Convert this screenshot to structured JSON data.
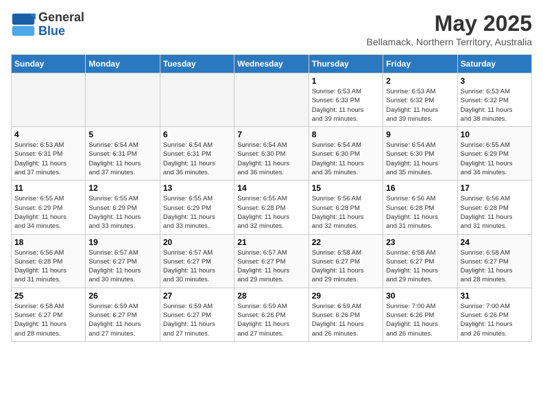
{
  "header": {
    "logo_line1": "General",
    "logo_line2": "Blue",
    "title": "May 2025",
    "subtitle": "Bellamack, Northern Territory, Australia"
  },
  "days_of_week": [
    "Sunday",
    "Monday",
    "Tuesday",
    "Wednesday",
    "Thursday",
    "Friday",
    "Saturday"
  ],
  "weeks": [
    [
      {
        "day": "",
        "empty": true
      },
      {
        "day": "",
        "empty": true
      },
      {
        "day": "",
        "empty": true
      },
      {
        "day": "",
        "empty": true
      },
      {
        "day": "1",
        "lines": [
          "Sunrise: 6:53 AM",
          "Sunset: 6:33 PM",
          "Daylight: 11 hours",
          "and 39 minutes."
        ]
      },
      {
        "day": "2",
        "lines": [
          "Sunrise: 6:53 AM",
          "Sunset: 6:32 PM",
          "Daylight: 11 hours",
          "and 39 minutes."
        ]
      },
      {
        "day": "3",
        "lines": [
          "Sunrise: 6:53 AM",
          "Sunset: 6:32 PM",
          "Daylight: 11 hours",
          "and 38 minutes."
        ]
      }
    ],
    [
      {
        "day": "4",
        "lines": [
          "Sunrise: 6:53 AM",
          "Sunset: 6:31 PM",
          "Daylight: 11 hours",
          "and 37 minutes."
        ]
      },
      {
        "day": "5",
        "lines": [
          "Sunrise: 6:54 AM",
          "Sunset: 6:31 PM",
          "Daylight: 11 hours",
          "and 37 minutes."
        ]
      },
      {
        "day": "6",
        "lines": [
          "Sunrise: 6:54 AM",
          "Sunset: 6:31 PM",
          "Daylight: 11 hours",
          "and 36 minutes."
        ]
      },
      {
        "day": "7",
        "lines": [
          "Sunrise: 6:54 AM",
          "Sunset: 6:30 PM",
          "Daylight: 11 hours",
          "and 36 minutes."
        ]
      },
      {
        "day": "8",
        "lines": [
          "Sunrise: 6:54 AM",
          "Sunset: 6:30 PM",
          "Daylight: 11 hours",
          "and 35 minutes."
        ]
      },
      {
        "day": "9",
        "lines": [
          "Sunrise: 6:54 AM",
          "Sunset: 6:30 PM",
          "Daylight: 11 hours",
          "and 35 minutes."
        ]
      },
      {
        "day": "10",
        "lines": [
          "Sunrise: 6:55 AM",
          "Sunset: 6:29 PM",
          "Daylight: 11 hours",
          "and 34 minutes."
        ]
      }
    ],
    [
      {
        "day": "11",
        "lines": [
          "Sunrise: 6:55 AM",
          "Sunset: 6:29 PM",
          "Daylight: 11 hours",
          "and 34 minutes."
        ]
      },
      {
        "day": "12",
        "lines": [
          "Sunrise: 6:55 AM",
          "Sunset: 6:29 PM",
          "Daylight: 11 hours",
          "and 33 minutes."
        ]
      },
      {
        "day": "13",
        "lines": [
          "Sunrise: 6:55 AM",
          "Sunset: 6:29 PM",
          "Daylight: 11 hours",
          "and 33 minutes."
        ]
      },
      {
        "day": "14",
        "lines": [
          "Sunrise: 6:55 AM",
          "Sunset: 6:28 PM",
          "Daylight: 11 hours",
          "and 32 minutes."
        ]
      },
      {
        "day": "15",
        "lines": [
          "Sunrise: 6:56 AM",
          "Sunset: 6:28 PM",
          "Daylight: 11 hours",
          "and 32 minutes."
        ]
      },
      {
        "day": "16",
        "lines": [
          "Sunrise: 6:56 AM",
          "Sunset: 6:28 PM",
          "Daylight: 11 hours",
          "and 31 minutes."
        ]
      },
      {
        "day": "17",
        "lines": [
          "Sunrise: 6:56 AM",
          "Sunset: 6:28 PM",
          "Daylight: 11 hours",
          "and 31 minutes."
        ]
      }
    ],
    [
      {
        "day": "18",
        "lines": [
          "Sunrise: 6:56 AM",
          "Sunset: 6:28 PM",
          "Daylight: 11 hours",
          "and 31 minutes."
        ]
      },
      {
        "day": "19",
        "lines": [
          "Sunrise: 6:57 AM",
          "Sunset: 6:27 PM",
          "Daylight: 11 hours",
          "and 30 minutes."
        ]
      },
      {
        "day": "20",
        "lines": [
          "Sunrise: 6:57 AM",
          "Sunset: 6:27 PM",
          "Daylight: 11 hours",
          "and 30 minutes."
        ]
      },
      {
        "day": "21",
        "lines": [
          "Sunrise: 6:57 AM",
          "Sunset: 6:27 PM",
          "Daylight: 11 hours",
          "and 29 minutes."
        ]
      },
      {
        "day": "22",
        "lines": [
          "Sunrise: 6:58 AM",
          "Sunset: 6:27 PM",
          "Daylight: 11 hours",
          "and 29 minutes."
        ]
      },
      {
        "day": "23",
        "lines": [
          "Sunrise: 6:58 AM",
          "Sunset: 6:27 PM",
          "Daylight: 11 hours",
          "and 29 minutes."
        ]
      },
      {
        "day": "24",
        "lines": [
          "Sunrise: 6:58 AM",
          "Sunset: 6:27 PM",
          "Daylight: 11 hours",
          "and 28 minutes."
        ]
      }
    ],
    [
      {
        "day": "25",
        "lines": [
          "Sunrise: 6:58 AM",
          "Sunset: 6:27 PM",
          "Daylight: 11 hours",
          "and 28 minutes."
        ]
      },
      {
        "day": "26",
        "lines": [
          "Sunrise: 6:59 AM",
          "Sunset: 6:27 PM",
          "Daylight: 11 hours",
          "and 27 minutes."
        ]
      },
      {
        "day": "27",
        "lines": [
          "Sunrise: 6:59 AM",
          "Sunset: 6:27 PM",
          "Daylight: 11 hours",
          "and 27 minutes."
        ]
      },
      {
        "day": "28",
        "lines": [
          "Sunrise: 6:59 AM",
          "Sunset: 6:26 PM",
          "Daylight: 11 hours",
          "and 27 minutes."
        ]
      },
      {
        "day": "29",
        "lines": [
          "Sunrise: 6:59 AM",
          "Sunset: 6:26 PM",
          "Daylight: 11 hours",
          "and 26 minutes."
        ]
      },
      {
        "day": "30",
        "lines": [
          "Sunrise: 7:00 AM",
          "Sunset: 6:26 PM",
          "Daylight: 11 hours",
          "and 26 minutes."
        ]
      },
      {
        "day": "31",
        "lines": [
          "Sunrise: 7:00 AM",
          "Sunset: 6:26 PM",
          "Daylight: 11 hours",
          "and 26 minutes."
        ]
      }
    ]
  ]
}
